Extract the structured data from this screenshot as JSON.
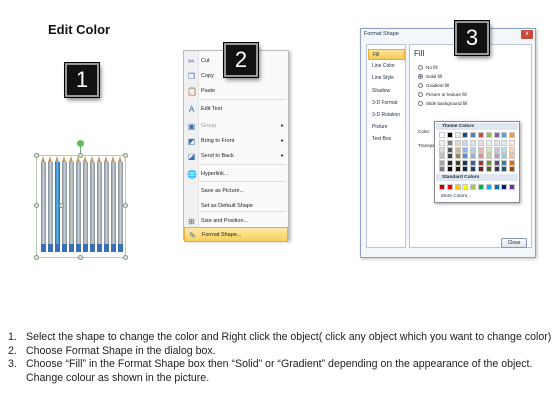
{
  "title": "Edit Color",
  "badges": [
    "1",
    "2",
    "3"
  ],
  "context_menu": {
    "items": [
      {
        "label": "Cut",
        "icon": "scissors-icon",
        "glyph": "✂",
        "disabled": false
      },
      {
        "label": "Copy",
        "icon": "copy-icon",
        "glyph": "❐",
        "disabled": false
      },
      {
        "label": "Paste",
        "icon": "paste-icon",
        "glyph": "📋",
        "disabled": false
      },
      {
        "label": "Edit Text",
        "icon": "edit-text-icon",
        "glyph": "A",
        "disabled": false
      },
      {
        "label": "Group",
        "icon": "group-icon",
        "glyph": "▣",
        "disabled": true,
        "submenu": true
      },
      {
        "label": "Bring to Front",
        "icon": "bring-front-icon",
        "glyph": "◩",
        "disabled": false,
        "submenu": true
      },
      {
        "label": "Send to Back",
        "icon": "send-back-icon",
        "glyph": "◪",
        "disabled": false,
        "submenu": true
      },
      {
        "label": "Hyperlink...",
        "icon": "hyperlink-icon",
        "glyph": "🌐",
        "disabled": false
      },
      {
        "label": "Save as Picture...",
        "icon": "",
        "glyph": "",
        "disabled": false
      },
      {
        "label": "Set as Default Shape",
        "icon": "",
        "glyph": "",
        "disabled": false
      },
      {
        "label": "Size and Position...",
        "icon": "size-icon",
        "glyph": "⊞",
        "disabled": false
      },
      {
        "label": "Format Shape...",
        "icon": "format-shape-icon",
        "glyph": "✎",
        "disabled": false,
        "highlighted": true
      }
    ]
  },
  "format_dialog": {
    "title": "Format Shape",
    "close_glyph": "x",
    "nav": [
      "Fill",
      "Line Color",
      "Line Style",
      "Shadow",
      "3-D Format",
      "3-D Rotation",
      "Picture",
      "Text Box"
    ],
    "selected_nav": "Fill",
    "section_title": "Fill",
    "options": [
      {
        "label": "No fill",
        "selected": false
      },
      {
        "label": "Solid fill",
        "selected": true
      },
      {
        "label": "Gradient fill",
        "selected": false
      },
      {
        "label": "Picture or texture fill",
        "selected": false
      },
      {
        "label": "Slide background fill",
        "selected": false
      }
    ],
    "color_label": "Color:",
    "transparency_label": "Transpa",
    "close_button": "Close"
  },
  "palette": {
    "theme_header": "Theme Colors",
    "standard_header": "Standard Colors",
    "more_colors": "More Colors...",
    "theme_top": [
      "#ffffff",
      "#000000",
      "#eeece1",
      "#1f497d",
      "#4f81bd",
      "#c0504d",
      "#9bbb59",
      "#8064a2",
      "#4bacc6",
      "#f79646"
    ],
    "theme_shades": [
      [
        "#f2f2f2",
        "#7f7f7f",
        "#ddd9c3",
        "#c6d9f0",
        "#dbe5f1",
        "#f2dcdb",
        "#ebf1dd",
        "#e5e0ec",
        "#dbeef3",
        "#fdeada"
      ],
      [
        "#d8d8d8",
        "#595959",
        "#c4bd97",
        "#8db3e2",
        "#b8cce4",
        "#e5b9b7",
        "#d7e3bc",
        "#ccc1d9",
        "#b7dde8",
        "#fbd5b5"
      ],
      [
        "#bfbfbf",
        "#3f3f3f",
        "#938953",
        "#548dd4",
        "#95b3d7",
        "#d99694",
        "#c3d69b",
        "#b2a2c7",
        "#92cddc",
        "#fac08f"
      ],
      [
        "#a5a5a5",
        "#262626",
        "#494429",
        "#17365d",
        "#366092",
        "#953734",
        "#76923c",
        "#5f497a",
        "#31859b",
        "#e36c09"
      ],
      [
        "#7f7f7f",
        "#0c0c0c",
        "#1d1b10",
        "#0f243e",
        "#244061",
        "#632423",
        "#4f6128",
        "#3f3151",
        "#205867",
        "#974806"
      ]
    ],
    "standard": [
      "#c00000",
      "#ff0000",
      "#ffc000",
      "#ffff00",
      "#92d050",
      "#00b050",
      "#00b0f0",
      "#0070c0",
      "#002060",
      "#7030a0"
    ]
  },
  "instructions": [
    {
      "num": "1.",
      "text": "Select the shape to change the color and Right click the object( click any object which you want to change color)"
    },
    {
      "num": "2.",
      "text": "Choose Format Shape in the dialog box."
    },
    {
      "num": "3.",
      "text": "Choose “Fill” in the Format Shape box then “Solid” or “Gradient” depending on the appearance of the object. Change colour as shown in the picture."
    }
  ],
  "colors": {
    "highlight": "#f7cf5c",
    "pencil_blue": "#1f6fb4",
    "pencil_gray": "#8a939a"
  }
}
